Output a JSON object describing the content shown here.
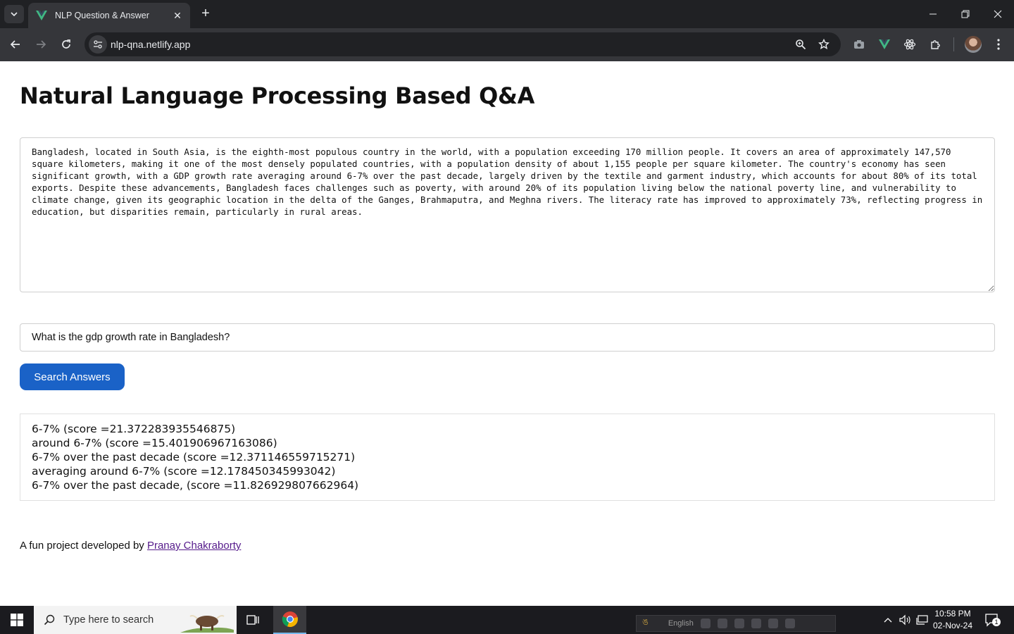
{
  "browser": {
    "tab_title": "NLP Question & Answer",
    "url": "nlp-qna.netlify.app",
    "colors": {
      "frame": "#202124",
      "toolbar": "#35363a",
      "vue_green": "#41b883"
    }
  },
  "page": {
    "title": "Natural Language Processing Based Q&A",
    "context_text": "Bangladesh, located in South Asia, is the eighth-most populous country in the world, with a population exceeding 170 million people. It covers an area of approximately 147,570 square kilometers, making it one of the most densely populated countries, with a population density of about 1,155 people per square kilometer. The country's economy has seen significant growth, with a GDP growth rate averaging around 6-7% over the past decade, largely driven by the textile and garment industry, which accounts for about 80% of its total exports. Despite these advancements, Bangladesh faces challenges such as poverty, with around 20% of its population living below the national poverty line, and vulnerability to climate change, given its geographic location in the delta of the Ganges, Brahmaputra, and Meghna rivers. The literacy rate has improved to approximately 73%, reflecting progress in education, but disparities remain, particularly in rural areas.",
    "question": "What is the gdp growth rate in Bangladesh?",
    "search_button": "Search Answers",
    "answers": [
      "6-7% (score =21.372283935546875)",
      "around 6-7% (score =15.401906967163086)",
      "6-7% over the past decade (score =12.371146559715271)",
      "averaging around 6-7% (score =12.178450345993042)",
      "6-7% over the past decade, (score =11.826929807662964)"
    ],
    "footer_text": "A fun project developed by ",
    "footer_link": "Pranay Chakraborty",
    "accent_color": "#1a62c7"
  },
  "taskbar": {
    "search_placeholder": "Type here to search",
    "language": "English",
    "time": "10:58 PM",
    "date": "02-Nov-24",
    "notification_count": "1"
  }
}
